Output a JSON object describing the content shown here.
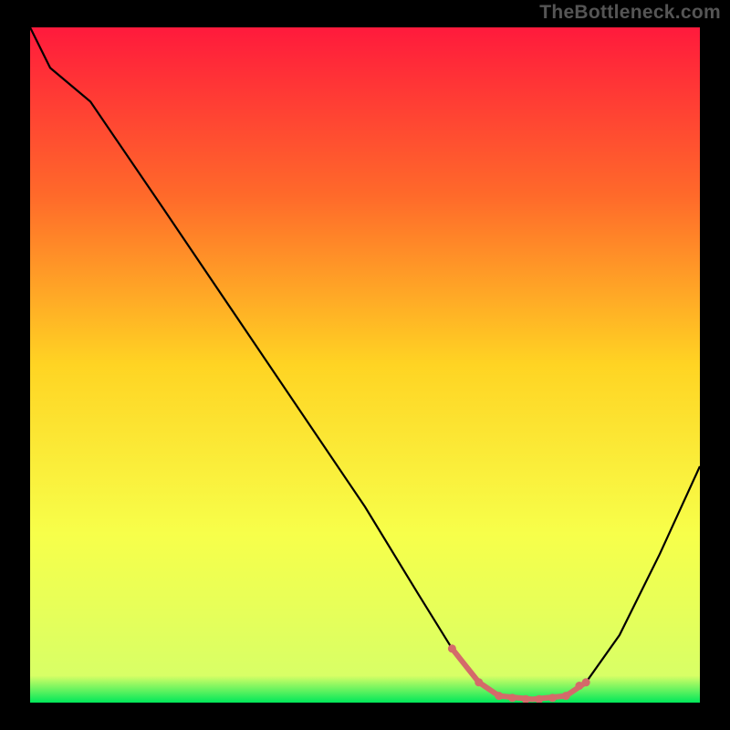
{
  "watermark": "TheBottleneck.com",
  "chart_data": {
    "type": "line",
    "title": "",
    "xlabel": "",
    "ylabel": "",
    "xlim": [
      0,
      100
    ],
    "ylim": [
      0,
      100
    ],
    "gradient_stops": [
      {
        "offset": 0,
        "color": "#ff1a3c"
      },
      {
        "offset": 25,
        "color": "#ff6a2a"
      },
      {
        "offset": 50,
        "color": "#ffd423"
      },
      {
        "offset": 75,
        "color": "#f7ff4a"
      },
      {
        "offset": 96,
        "color": "#d8ff66"
      },
      {
        "offset": 100,
        "color": "#00e85a"
      }
    ],
    "series": [
      {
        "name": "curve",
        "stroke": "#000000",
        "points": [
          {
            "x": 0,
            "y": 100
          },
          {
            "x": 3,
            "y": 94
          },
          {
            "x": 9,
            "y": 89
          },
          {
            "x": 20,
            "y": 73
          },
          {
            "x": 35,
            "y": 51
          },
          {
            "x": 50,
            "y": 29
          },
          {
            "x": 58,
            "y": 16
          },
          {
            "x": 63,
            "y": 8
          },
          {
            "x": 67,
            "y": 3
          },
          {
            "x": 70,
            "y": 1
          },
          {
            "x": 75,
            "y": 0.5
          },
          {
            "x": 80,
            "y": 1
          },
          {
            "x": 83,
            "y": 3
          },
          {
            "x": 88,
            "y": 10
          },
          {
            "x": 94,
            "y": 22
          },
          {
            "x": 100,
            "y": 35
          }
        ]
      },
      {
        "name": "highlight-segment",
        "stroke": "#d46a6a",
        "stroke_width": 6,
        "x_range": [
          63,
          83
        ],
        "points": [
          {
            "x": 63,
            "y": 8
          },
          {
            "x": 67,
            "y": 3
          },
          {
            "x": 70,
            "y": 1
          },
          {
            "x": 75,
            "y": 0.5
          },
          {
            "x": 80,
            "y": 1
          },
          {
            "x": 83,
            "y": 3
          }
        ],
        "markers": [
          {
            "x": 63,
            "y": 8
          },
          {
            "x": 67,
            "y": 3
          },
          {
            "x": 70,
            "y": 1
          },
          {
            "x": 72,
            "y": 0.7
          },
          {
            "x": 74,
            "y": 0.5
          },
          {
            "x": 76,
            "y": 0.5
          },
          {
            "x": 78,
            "y": 0.7
          },
          {
            "x": 80,
            "y": 1
          },
          {
            "x": 82,
            "y": 2.5
          },
          {
            "x": 83,
            "y": 3
          }
        ]
      }
    ]
  }
}
